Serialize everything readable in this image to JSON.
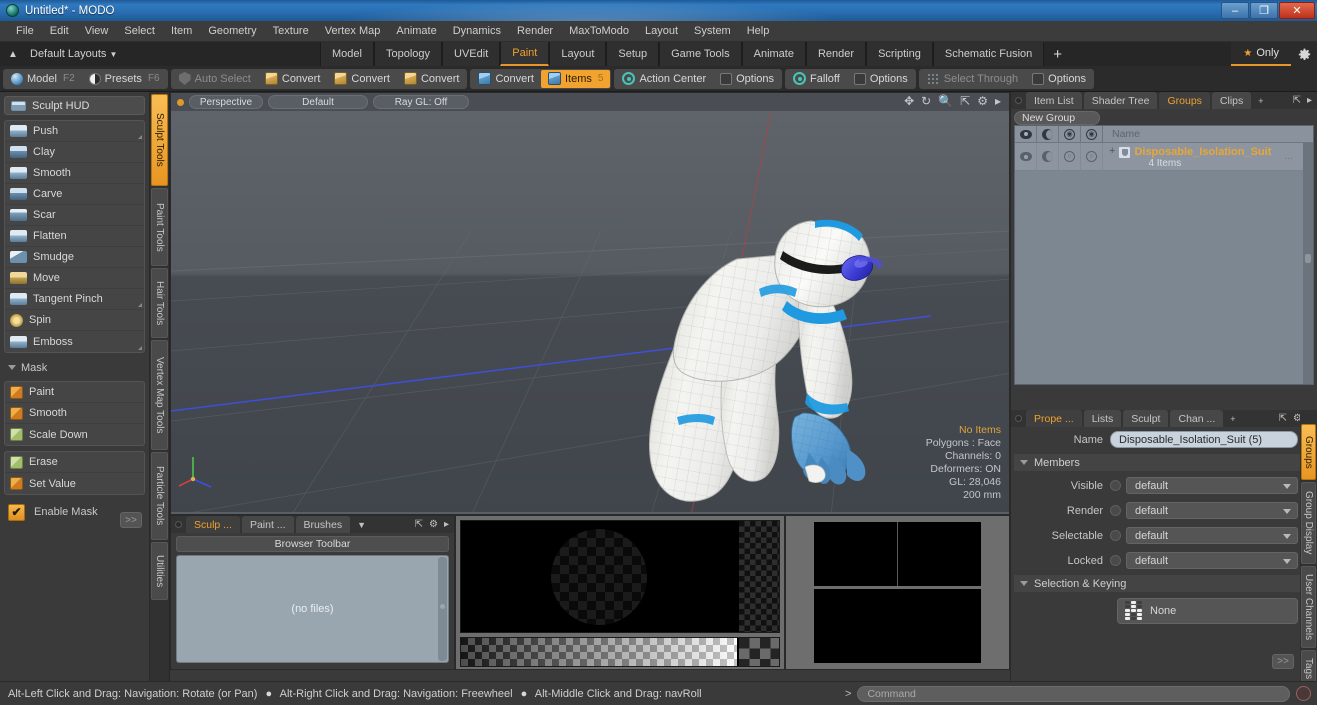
{
  "window": {
    "title": "Untitled* - MODO",
    "icon": "modo-logo-icon",
    "minimize": "–",
    "maximize": "❐",
    "close": "✕"
  },
  "menu": {
    "items": [
      "File",
      "Edit",
      "View",
      "Select",
      "Item",
      "Geometry",
      "Texture",
      "Vertex Map",
      "Animate",
      "Dynamics",
      "Render",
      "MaxToModo",
      "Layout",
      "System",
      "Help"
    ]
  },
  "layout_bar": {
    "home_icon": "home-arrow-icon",
    "layouts_label": "Default Layouts",
    "layouts_caret": "▼",
    "tabs": [
      {
        "label": "Model",
        "active": false
      },
      {
        "label": "Topology",
        "active": false
      },
      {
        "label": "UVEdit",
        "active": false
      },
      {
        "label": "Paint",
        "active": true
      },
      {
        "label": "Layout",
        "active": false
      },
      {
        "label": "Setup",
        "active": false
      },
      {
        "label": "Game Tools",
        "active": false
      },
      {
        "label": "Animate",
        "active": false
      },
      {
        "label": "Render",
        "active": false
      },
      {
        "label": "Scripting",
        "active": false
      },
      {
        "label": "Schematic Fusion",
        "active": false
      }
    ],
    "add_tab": "+",
    "only_label": "Only",
    "only_star": "★",
    "gear_icon": "gear-icon"
  },
  "mode_toolbar": {
    "groups": [
      {
        "buttons": [
          {
            "label": "Model",
            "hotkey": "F2",
            "icon": "sphere-icon",
            "state": "normal"
          },
          {
            "label": "Presets",
            "hotkey": "F6",
            "icon": "half-sphere-icon",
            "state": "normal"
          }
        ]
      },
      {
        "buttons": [
          {
            "label": "Auto Select",
            "hotkey": "",
            "icon": "shield-icon",
            "state": "disabled"
          },
          {
            "label": "Convert",
            "hotkey": "",
            "icon": "vertex-box-icon",
            "state": "normal"
          },
          {
            "label": "Convert",
            "hotkey": "",
            "icon": "edge-box-icon",
            "state": "normal"
          },
          {
            "label": "Convert",
            "hotkey": "",
            "icon": "polygon-box-icon",
            "state": "normal"
          }
        ]
      },
      {
        "buttons": [
          {
            "label": "Convert",
            "hotkey": "",
            "icon": "item-box-icon",
            "state": "normal"
          },
          {
            "label": "Items",
            "hotkey": "5",
            "icon": "item-box-icon",
            "state": "active"
          }
        ]
      },
      {
        "buttons": [
          {
            "label": "Action Center",
            "hotkey": "",
            "icon": "action-center-icon",
            "state": "normal"
          },
          {
            "label": "Options",
            "hotkey": "",
            "icon": "checkbox-icon",
            "state": "normal"
          }
        ]
      },
      {
        "buttons": [
          {
            "label": "Falloff",
            "hotkey": "",
            "icon": "falloff-icon",
            "state": "normal"
          },
          {
            "label": "Options",
            "hotkey": "",
            "icon": "checkbox-icon",
            "state": "normal"
          }
        ]
      },
      {
        "buttons": [
          {
            "label": "Select Through",
            "hotkey": "",
            "icon": "select-through-icon",
            "state": "disabled"
          },
          {
            "label": "Options",
            "hotkey": "",
            "icon": "checkbox-icon",
            "state": "normal"
          }
        ]
      }
    ]
  },
  "left_panel": {
    "sculpt_hud": {
      "label": "Sculpt HUD",
      "icon": "hud-icon"
    },
    "brush_tools": [
      {
        "label": "Push",
        "icon": "push-brush-icon",
        "corner": true
      },
      {
        "label": "Clay",
        "icon": "clay-brush-icon",
        "corner": false
      },
      {
        "label": "Smooth",
        "icon": "smooth-brush-icon",
        "corner": false
      },
      {
        "label": "Carve",
        "icon": "carve-brush-icon",
        "corner": false
      },
      {
        "label": "Scar",
        "icon": "scar-brush-icon",
        "corner": false
      },
      {
        "label": "Flatten",
        "icon": "flatten-brush-icon",
        "corner": false
      },
      {
        "label": "Smudge",
        "icon": "smudge-brush-icon",
        "corner": false
      },
      {
        "label": "Move",
        "icon": "move-brush-icon",
        "corner": false
      },
      {
        "label": "Tangent Pinch",
        "icon": "tangent-pinch-icon",
        "corner": true
      },
      {
        "label": "Spin",
        "icon": "spin-brush-icon",
        "corner": false
      },
      {
        "label": "Emboss",
        "icon": "emboss-brush-icon",
        "corner": true
      }
    ],
    "mask_section": {
      "label": "Mask",
      "caret": "▼"
    },
    "mask_tools_a": [
      {
        "label": "Paint",
        "icon": "mask-paint-icon"
      },
      {
        "label": "Smooth",
        "icon": "mask-smooth-icon"
      },
      {
        "label": "Scale Down",
        "icon": "mask-scale-down-icon"
      }
    ],
    "mask_tools_b": [
      {
        "label": "Erase",
        "icon": "mask-erase-icon"
      },
      {
        "label": "Set Value",
        "icon": "mask-set-value-icon"
      }
    ],
    "enable_mask": {
      "label": "Enable Mask",
      "checked": true,
      "check": "✔"
    },
    "expand": ">>",
    "vertical_tabs": [
      {
        "label": "Sculpt Tools",
        "active": true
      },
      {
        "label": "Paint Tools",
        "active": false
      },
      {
        "label": "Hair Tools",
        "active": false
      },
      {
        "label": "Vertex Map Tools",
        "active": false
      },
      {
        "label": "Particle Tools",
        "active": false
      },
      {
        "label": "Utilities",
        "active": false
      }
    ]
  },
  "viewport": {
    "view_dot": "viewport-menu-dot",
    "pills": [
      "Perspective",
      "Default",
      "Ray GL: Off"
    ],
    "nav_icons": [
      "pan-icon",
      "rotate-icon",
      "zoom-icon",
      "fit-icon",
      "settings-icon",
      "more-icon"
    ],
    "hud": {
      "selection": "No Items",
      "polygons": "Polygons : Face",
      "channels": "Channels: 0",
      "deformers": "Deformers: ON",
      "gl": "GL: 28,046",
      "scale": "200 mm"
    },
    "model_name": "Disposable Isolation Suit"
  },
  "browser_panel": {
    "tabs": [
      {
        "label": "Sculp ...",
        "active": true
      },
      {
        "label": "Paint ...",
        "active": false
      },
      {
        "label": "Brushes",
        "active": false
      }
    ],
    "caret": "▼",
    "expand_icon": "expand-icon",
    "gear_icon": "gear-icon",
    "more_icon": "more-icon",
    "toolbar_label": "Browser Toolbar",
    "empty_text": "(no files)"
  },
  "right_panel": {
    "tabs": [
      {
        "label": "Item List",
        "active": false
      },
      {
        "label": "Shader Tree",
        "active": false
      },
      {
        "label": "Groups",
        "active": true
      },
      {
        "label": "Clips",
        "active": false
      }
    ],
    "add_tab": "+",
    "expand_icon": "expand-icon",
    "more_icon": "more-icon",
    "new_group_label": "New Group",
    "list_header": {
      "columns": [
        "visible-eye-icon",
        "shading-moon-icon",
        "render-icon",
        "render-alt-icon"
      ],
      "name": "Name"
    },
    "rows": [
      {
        "plus": "+",
        "icon": "group-icon",
        "name": "Disposable_Isolation_Suit",
        "subtitle": "4 Items",
        "ellipsis": "..."
      }
    ]
  },
  "properties": {
    "tabs": [
      {
        "label": "Prope ...",
        "active": true
      },
      {
        "label": "Lists",
        "active": false
      },
      {
        "label": "Sculpt",
        "active": false
      },
      {
        "label": "Chan ...",
        "active": false
      }
    ],
    "add_tab": "+",
    "expand_icon": "expand-icon",
    "gear_icon": "gear-icon",
    "more_icon": "more-icon",
    "name_label": "Name",
    "name_value": "Disposable_Isolation_Suit (5)",
    "members_section": {
      "label": "Members",
      "caret": "▼"
    },
    "fields": [
      {
        "label": "Visible",
        "value": "default"
      },
      {
        "label": "Render",
        "value": "default"
      },
      {
        "label": "Selectable",
        "value": "default"
      },
      {
        "label": "Locked",
        "value": "default"
      }
    ],
    "selection_section": {
      "label": "Selection & Keying",
      "caret": "▼"
    },
    "selection_value": "None",
    "expand": ">>",
    "vertical_tabs": [
      {
        "label": "Groups",
        "active": true
      },
      {
        "label": "Group Display",
        "active": false
      },
      {
        "label": "User Channels",
        "active": false
      },
      {
        "label": "Tags",
        "active": false
      }
    ]
  },
  "status_bar": {
    "hints": [
      "Alt-Left Click and Drag: Navigation: Rotate (or Pan)",
      "Alt-Right Click and Drag: Navigation: Freewheel",
      "Alt-Middle Click and Drag: navRoll"
    ],
    "bullet": "●",
    "command_caret": ">",
    "command_placeholder": "Command",
    "record_icon": "record-icon"
  },
  "colors": {
    "accent": "#e8952a",
    "panel": "#3a3a3a",
    "viewport_bg": "#4a4e54",
    "list_bg": "#8d96a0",
    "suit_white": "#f2f2f0",
    "suit_blue": "#1f9ae0",
    "glove_blue": "#5a9fd4"
  }
}
